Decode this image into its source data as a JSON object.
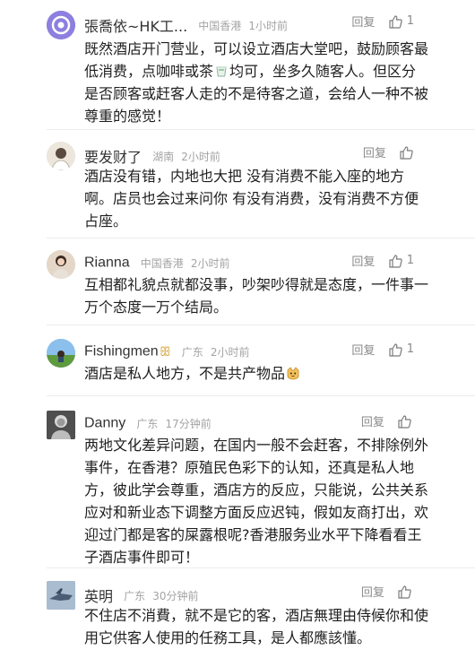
{
  "comments": [
    {
      "user": "張喬依~HK工...",
      "location": "中国香港",
      "time": "1小时前",
      "reply_label": "回复",
      "like_count": "1",
      "lines": [
        "既然酒店开门营业，可以设立酒店大堂吧，鼓励顾客最",
        "低消费，点咖啡或茶",
        "均可，坐多久随客人。但区分",
        "是否顾客或赶客人走的不是待客之道，会给人一种不被",
        "尊重的感觉！"
      ]
    },
    {
      "user": "要发财了",
      "location": "湖南",
      "time": "2小时前",
      "reply_label": "回复",
      "like_count": "",
      "lines": [
        "酒店没有错，内地也大把  没有消费不能入座的地方",
        "啊。店员也会过来问你  有没有消费，没有消费不方便",
        "占座。"
      ]
    },
    {
      "user": "Rianna",
      "location": "中国香港",
      "time": "2小时前",
      "reply_label": "回复",
      "like_count": "1",
      "lines": [
        "互相都礼貌点就都没事，吵架吵得就是态度，一件事一",
        "万个态度一万个结局。"
      ]
    },
    {
      "user": "Fishingmen",
      "location": "广东",
      "time": "2小时前",
      "reply_label": "回复",
      "like_count": "1",
      "lines": [
        "酒店是私人地方，不是共产物品"
      ]
    },
    {
      "user": "Danny",
      "location": "广东",
      "time": "17分钟前",
      "reply_label": "回复",
      "like_count": "",
      "lines": [
        "两地文化差异问题，在国内一般不会赶客，不排除例外",
        "事件，在香港？原殖民色彩下的认知，还真是私人地",
        "方，彼此学会尊重，酒店方的反应，只能说，公共关系",
        "应对和新业态下调整方面反应迟钝，假如友商打出，欢",
        "迎过门都是客的屎露根呢?香港服务业水平下降看看王",
        "子酒店事件即可！"
      ]
    },
    {
      "user": "英明",
      "location": "广东",
      "time": "30分钟前",
      "reply_label": "回复",
      "like_count": "",
      "lines": [
        "不住店不消費，就不是它的客，酒店無理由侍候你和使",
        "用它供客人使用的任務工具，是人都應該懂。"
      ]
    }
  ],
  "icons": {
    "like": "thumbs-up-icon",
    "tea": "tea-cup-icon",
    "cat": "cat-face-icon",
    "ribbon": "ribbon-icon"
  },
  "colors": {
    "name": "#333333",
    "meta": "#a3a3a3",
    "text": "#1e1e1e",
    "action": "#8a8a8a"
  }
}
